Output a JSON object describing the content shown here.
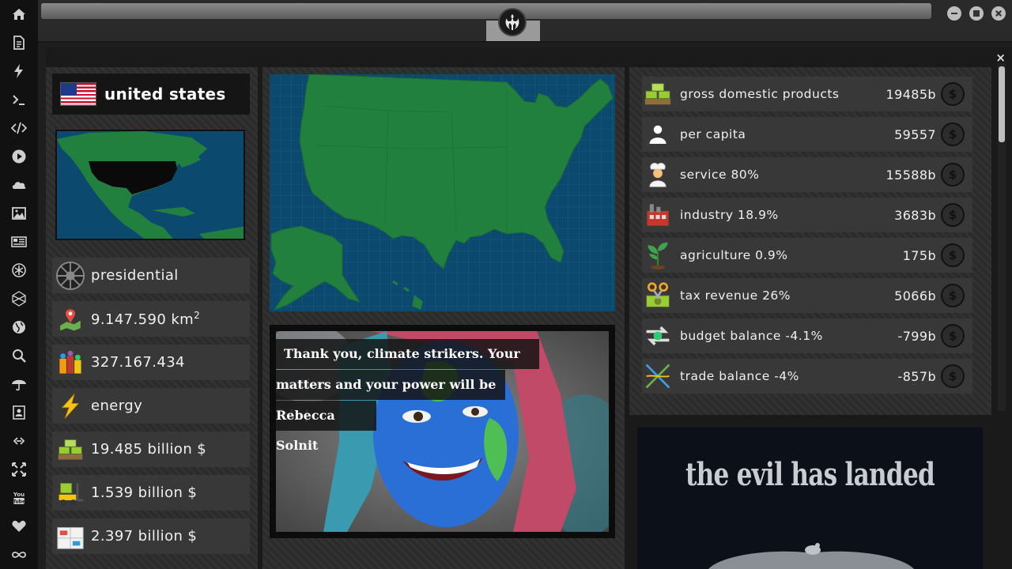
{
  "app": {
    "logo_icon": "rebel-alliance-icon"
  },
  "window": {
    "minimize": "minimize-icon",
    "maximize": "maximize-icon",
    "close": "close-icon"
  },
  "panel": {
    "close_label": "×"
  },
  "rail": [
    "home-icon",
    "document-icon",
    "lightning-icon",
    "terminal-icon",
    "code-icon",
    "play-icon",
    "cloud-icon",
    "image-icon",
    "newspaper-icon",
    "asterisk-icon",
    "hexagon-icon",
    "globe-icon",
    "search-icon",
    "umbrella-icon",
    "contact-icon",
    "link-icon",
    "expand-icon",
    "youtube-icon",
    "heart-icon",
    "infinity-icon"
  ],
  "country": {
    "name": "united states",
    "stats": [
      {
        "icon": "empire-emblem-icon",
        "text": "presidential"
      },
      {
        "icon": "map-pin-icon",
        "text": "9.147.590 km",
        "sup": "2"
      },
      {
        "icon": "population-icon",
        "text": "327.167.434"
      },
      {
        "icon": "energy-bolt-icon",
        "text": "energy"
      },
      {
        "icon": "money-stack-icon",
        "text": "19.485 billion $"
      },
      {
        "icon": "forklift-money-icon",
        "text": "1.539 billion $"
      },
      {
        "icon": "boxes-icon",
        "text": "2.397 billion $"
      }
    ]
  },
  "news": {
    "lines": [
      "Thank you, climate strikers. Your action",
      "matters and your power will be felt |",
      "Rebecca Solnit"
    ]
  },
  "economy": [
    {
      "icon": "money-stack-icon",
      "label": "gross domestic products",
      "value": "19485b"
    },
    {
      "icon": "person-icon",
      "label": "per capita",
      "value": "59557"
    },
    {
      "icon": "chef-icon",
      "label": "service 80%",
      "value": "15588b"
    },
    {
      "icon": "factory-icon",
      "label": "industry 18.9%",
      "value": "3683b"
    },
    {
      "icon": "plant-icon",
      "label": "agriculture 0.9%",
      "value": "175b"
    },
    {
      "icon": "scissors-money-icon",
      "label": "tax revenue 26%",
      "value": "5066b"
    },
    {
      "icon": "balance-arrows-icon",
      "label": "budget balance -4.1%",
      "value": "-799b"
    },
    {
      "icon": "trade-cross-icon",
      "label": "trade balance -4%",
      "value": "-857b"
    }
  ],
  "coin_symbol": "$",
  "promo": {
    "title": "the evil has landed"
  },
  "colors": {
    "map_ocean": "#0b4a6e",
    "map_land": "#22803f",
    "accent_dark": "#111111"
  }
}
